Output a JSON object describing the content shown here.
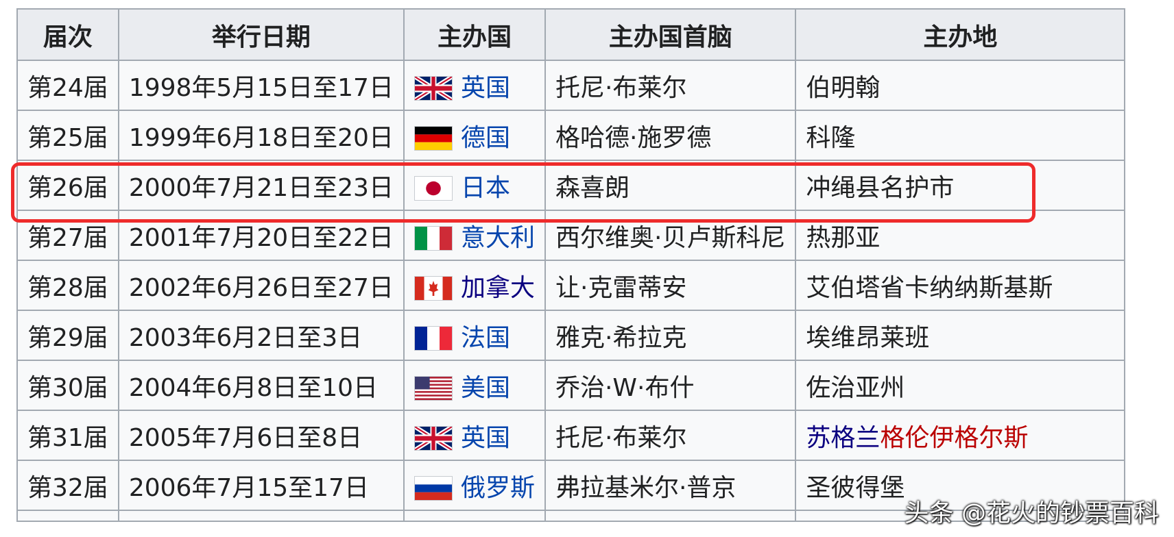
{
  "headers": [
    "届次",
    "举行日期",
    "主办国",
    "主办国首脑",
    "主办地"
  ],
  "rows": [
    {
      "session": "第24届",
      "date": "1998年5月15日至17日",
      "flag": "uk-flag-icon",
      "country": "英国",
      "leader": "托尼·布莱尔",
      "place": "伯明翰"
    },
    {
      "session": "第25届",
      "date": "1999年6月18日至20日",
      "flag": "germany-flag-icon",
      "country": "德国",
      "leader": "格哈德·施罗德",
      "place": "科隆"
    },
    {
      "session": "第26届",
      "date": "2000年7月21日至23日",
      "flag": "japan-flag-icon",
      "country": "日本",
      "leader": "森喜朗",
      "place": "冲绳县名护市"
    },
    {
      "session": "第27届",
      "date": "2001年7月20日至22日",
      "flag": "italy-flag-icon",
      "country": "意大利",
      "leader": "西尔维奥·贝卢斯科尼",
      "place": "热那亚"
    },
    {
      "session": "第28届",
      "date": "2002年6月26日至27日",
      "flag": "canada-flag-icon",
      "country": "加拿大",
      "leader": "让·克雷蒂安",
      "place": "艾伯塔省卡纳纳斯基斯"
    },
    {
      "session": "第29届",
      "date": "2003年6月2日至3日",
      "flag": "france-flag-icon",
      "country": "法国",
      "leader": "雅克·希拉克",
      "place": "埃维昂莱班"
    },
    {
      "session": "第30届",
      "date": "2004年6月8日至10日",
      "flag": "usa-flag-icon",
      "country": "美国",
      "leader": "乔治·W·布什",
      "place": "佐治亚州"
    },
    {
      "session": "第31届",
      "date": "2005年7月6日至8日",
      "flag": "uk-flag-icon",
      "country": "英国",
      "leader": "托尼·布莱尔",
      "place_a": "苏格兰",
      "place_b": "格伦伊格尔斯"
    },
    {
      "session": "第32届",
      "date": "2006年7月15至17日",
      "flag": "russia-flag-icon",
      "country": "俄罗斯",
      "leader": "弗拉基米尔·普京",
      "place": "圣彼得堡"
    }
  ],
  "watermark": "头条 @花火的钞票百科",
  "colors": {
    "link": "#0645ad",
    "visited": "#0b0080",
    "redlink": "#ba0000",
    "highlight": "#ee2b2b"
  }
}
